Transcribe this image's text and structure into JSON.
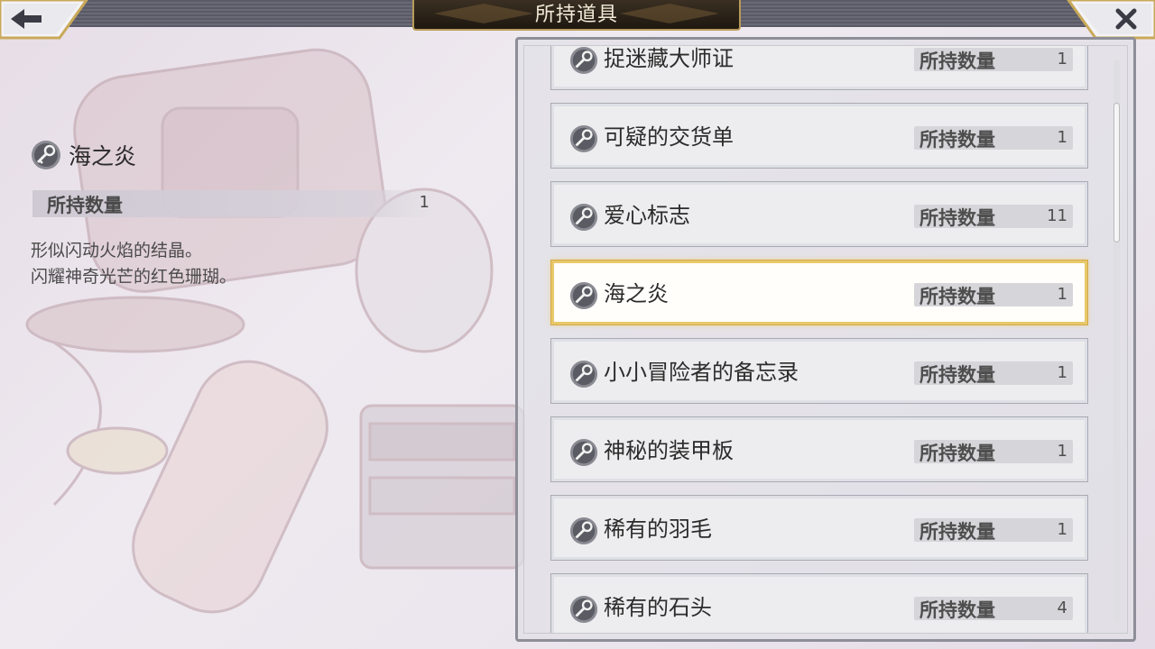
{
  "header": {
    "title": "所持道具",
    "back_icon": "arrow-left-icon",
    "close_icon": "close-x-icon"
  },
  "colors": {
    "accent_gold": "#e8c86a",
    "title_plate": "#2a2218",
    "item_bg": "#ededef"
  },
  "detail": {
    "icon": "key-medal-icon",
    "name": "海之炎",
    "qty_label": "所持数量",
    "qty_value": "1",
    "desc_line1": "形似闪动火焰的结晶。",
    "desc_line2": "闪耀神奇光芒的红色珊瑚。"
  },
  "list": {
    "selected_index": 3,
    "items": [
      {
        "name": "捉迷藏大师证",
        "qty_label": "所持数量",
        "qty": "1"
      },
      {
        "name": "可疑的交货单",
        "qty_label": "所持数量",
        "qty": "1"
      },
      {
        "name": "爱心标志",
        "qty_label": "所持数量",
        "qty": "11"
      },
      {
        "name": "海之炎",
        "qty_label": "所持数量",
        "qty": "1"
      },
      {
        "name": "小小冒险者的备忘录",
        "qty_label": "所持数量",
        "qty": "1"
      },
      {
        "name": "神秘的装甲板",
        "qty_label": "所持数量",
        "qty": "1"
      },
      {
        "name": "稀有的羽毛",
        "qty_label": "所持数量",
        "qty": "1"
      },
      {
        "name": "稀有的石头",
        "qty_label": "所持数量",
        "qty": "4"
      }
    ]
  }
}
